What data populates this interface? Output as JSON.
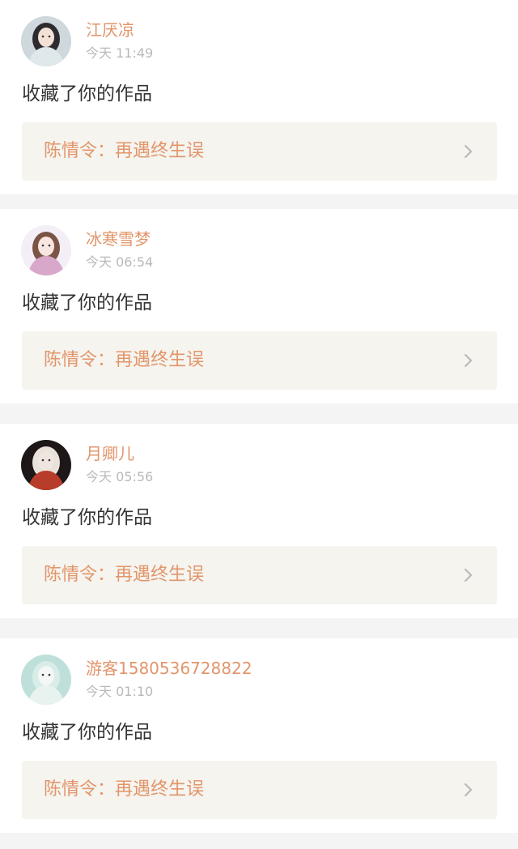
{
  "notifications": [
    {
      "username": "江厌凉",
      "time": "今天 11:49",
      "action": "收藏了你的作品",
      "work_title": "陈情令：再遇终生误",
      "avatar_icon": "avatar-girl-white-robe",
      "avatar_colors": {
        "bg": "#cfd8dc",
        "hair": "#2e2b2f",
        "skin": "#f3e1d5",
        "clothes": "#dfe8ea"
      }
    },
    {
      "username": "冰寒雪梦",
      "time": "今天 06:54",
      "action": "收藏了你的作品",
      "work_title": "陈情令：再遇终生误",
      "avatar_icon": "avatar-girl-pink-dress",
      "avatar_colors": {
        "bg": "#f4eef6",
        "hair": "#7a5546",
        "skin": "#f8e6e0",
        "clothes": "#d8a7c9"
      }
    },
    {
      "username": "月卿儿",
      "time": "今天 05:56",
      "action": "收藏了你的作品",
      "work_title": "陈情令：再遇终生误",
      "avatar_icon": "avatar-girl-red-dark",
      "avatar_colors": {
        "bg": "#1d1718",
        "hair": "#e8e2db",
        "skin": "#efe6df",
        "clothes": "#b83c2a"
      }
    },
    {
      "username": "游客1580536728822",
      "time": "今天 01:10",
      "action": "收藏了你的作品",
      "work_title": "陈情令：再遇终生误",
      "avatar_icon": "avatar-girl-mint",
      "avatar_colors": {
        "bg": "#bfe0da",
        "hair": "#d8ece8",
        "skin": "#f4f7f6",
        "clothes": "#e8f3f0"
      }
    }
  ]
}
